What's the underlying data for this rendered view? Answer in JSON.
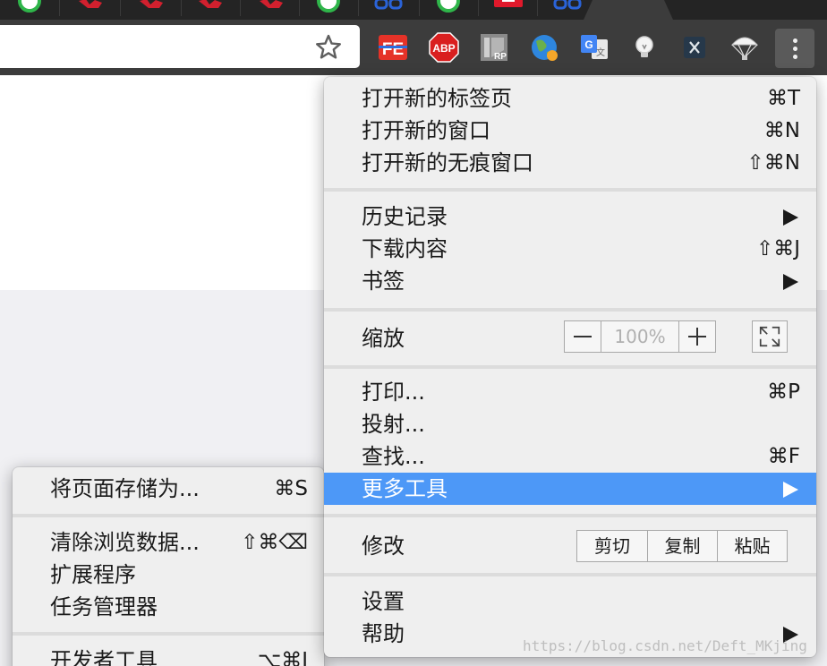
{
  "menu": {
    "group1": [
      {
        "label": "打开新的标签页",
        "shortcut": "⌘T"
      },
      {
        "label": "打开新的窗口",
        "shortcut": "⌘N"
      },
      {
        "label": "打开新的无痕窗口",
        "shortcut": "⇧⌘N"
      }
    ],
    "group2": [
      {
        "label": "历史记录",
        "submenu": true
      },
      {
        "label": "下载内容",
        "shortcut": "⇧⌘J"
      },
      {
        "label": "书签",
        "submenu": true
      }
    ],
    "zoom": {
      "label": "缩放",
      "value": "100%"
    },
    "group4": [
      {
        "label": "打印...",
        "shortcut": "⌘P"
      },
      {
        "label": "投射..."
      },
      {
        "label": "查找...",
        "shortcut": "⌘F"
      },
      {
        "label": "更多工具",
        "submenu": true,
        "highlighted": true
      }
    ],
    "edit": {
      "label": "修改",
      "cut": "剪切",
      "copy": "复制",
      "paste": "粘贴"
    },
    "group6": [
      {
        "label": "设置"
      },
      {
        "label": "帮助",
        "submenu": true
      }
    ]
  },
  "submenu": {
    "items": [
      {
        "label": "将页面存储为...",
        "shortcut": "⌘S"
      },
      {
        "label": "清除浏览数据...",
        "shortcut": "⇧⌘⌫"
      },
      {
        "label": "扩展程序"
      },
      {
        "label": "任务管理器"
      },
      {
        "label": "开发者工具",
        "shortcut": "⌥⌘I"
      }
    ]
  },
  "extensions": {
    "fe": "FE",
    "abp": "ABP",
    "rp": "RP"
  },
  "icons": [
    "star-icon",
    "fe-helper-icon",
    "adblock-plus-icon",
    "axure-rp-icon",
    "globe-icon",
    "google-translate-icon",
    "lightbulb-icon",
    "x-extension-icon",
    "parachute-icon",
    "kebab-menu-icon"
  ],
  "colors": {
    "highlight": "#4d98f7",
    "toolbar": "#3c3c3c",
    "menu_bg": "#efefef"
  },
  "watermark": "https://blog.csdn.net/Deft_MKjing"
}
